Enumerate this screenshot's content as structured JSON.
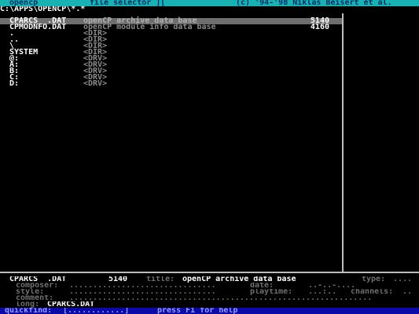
{
  "titlebar": {
    "left": "opencp",
    "center": "file selector ][",
    "right": "(c) '94-'98 Niklas Beisert et al."
  },
  "path": "C:\\APPS\\OPENCP\\*.*",
  "files": [
    {
      "name": "CPARCS  .DAT",
      "desc": "openCP archive data base",
      "size": "5140",
      "selected": true
    },
    {
      "name": "CPMODNFO.DAT",
      "desc": "openCP module info data base",
      "size": "4160",
      "selected": false
    }
  ],
  "dirs": [
    {
      "name": ".",
      "type": "<DIR>"
    },
    {
      "name": "..",
      "type": "<DIR>"
    },
    {
      "name": "\\",
      "type": "<DIR>"
    },
    {
      "name": "SYSTEM",
      "type": "<DIR>"
    },
    {
      "name": "@:",
      "type": "<DRV>"
    },
    {
      "name": "A:",
      "type": "<DRV>"
    },
    {
      "name": "B:",
      "type": "<DRV>"
    },
    {
      "name": "C:",
      "type": "<DRV>"
    },
    {
      "name": "D:",
      "type": "<DRV>"
    }
  ],
  "info": {
    "filename": "CPARCS  .DAT",
    "size": "5140",
    "title_label": "title:",
    "title": "openCP archive data base",
    "type_label": "type:",
    "type_value": "....",
    "composer_label": "composer:",
    "composer_value": "...............................",
    "date_label": "date:",
    "date_value": "..-..-....",
    "style_label": "style:",
    "style_value": "...............................",
    "playtime_label": "playtime:",
    "playtime_value": "...:..",
    "channels_label": "channels:",
    "channels_value": "..",
    "comment_label": "comment:",
    "comment_value": "................................................................",
    "long_label": "long:",
    "long_value": "CPARCS.DAT"
  },
  "quickfind": {
    "label": "quickfind:",
    "field": "[............]",
    "hint": "press F1 for help"
  }
}
